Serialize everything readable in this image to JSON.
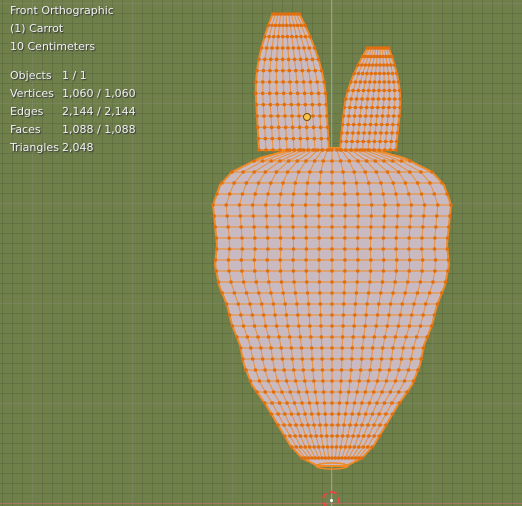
{
  "viewport": {
    "view_name": "Front Orthographic",
    "object_name": "(1) Carrot",
    "grid_scale": "10 Centimeters"
  },
  "stats": [
    {
      "label": "Objects",
      "value": "1 / 1"
    },
    {
      "label": "Vertices",
      "value": "1,060 / 1,060"
    },
    {
      "label": "Edges",
      "value": "2,144 / 2,144"
    },
    {
      "label": "Faces",
      "value": "1,088 / 1,088"
    },
    {
      "label": "Triangles",
      "value": "2,048"
    }
  ],
  "colors": {
    "background": "#6f804b",
    "mesh_fill": "#c9b9c1",
    "wire": "#f08a24",
    "vertex": "#e06f10"
  },
  "icons": [
    "3d-cursor-icon",
    "object-origin-icon"
  ]
}
